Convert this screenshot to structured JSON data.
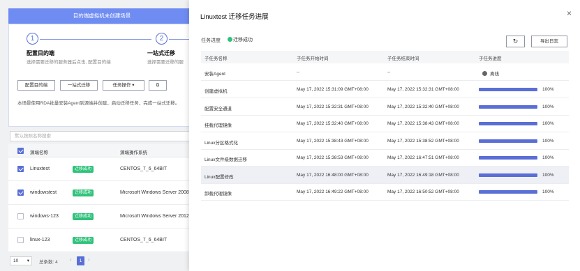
{
  "background": {
    "banner": "目的端虚拟机未创建场景",
    "steps": [
      {
        "number": "1",
        "title": "配置目的端",
        "desc": "选择需要迁移的服务器后点击, 配置目的端"
      },
      {
        "number": "2",
        "title": "一站式迁移",
        "desc": "选择需要迁移的服"
      }
    ],
    "buttons": {
      "configure": "配置目的端",
      "oneStop": "一站式迁移",
      "taskOps": "任务操作",
      "taskOpsCaret": "▾",
      "external": "⧉"
    },
    "intro": "本场景使用RDA批量安装Agent到源端并创建，启动迁移任务，完成一站式迁移。",
    "search_placeholder": "默认按照名称搜索",
    "table": {
      "headers": {
        "name": "源端名称",
        "os": "源端操作系统"
      },
      "rows": [
        {
          "name": "Linuxtest",
          "status": "迁移成功",
          "os": "CENTOS_7_6_64BIT",
          "checked": true
        },
        {
          "name": "windowstest",
          "status": "迁移成功",
          "os": "Microsoft Windows Server 2008",
          "checked": true
        },
        {
          "name": "windows-123",
          "status": "迁移成功",
          "os": "Microsoft Windows Server 2012",
          "checked": false
        },
        {
          "name": "linux-123",
          "status": "迁移成功",
          "os": "CENTOS_7_6_64BIT",
          "checked": false
        }
      ]
    },
    "pager": {
      "pageSize": "10",
      "total": "总条数: 4",
      "current": "1",
      "prev": "‹",
      "next": "›"
    }
  },
  "panel": {
    "title": "Linuxtest 迁移任务进展",
    "close": "×",
    "progressLabel": "任务进度",
    "progressStatus": "迁移成功",
    "refresh": "↻",
    "export": "导出日志",
    "headers": {
      "name": "子任务名称",
      "start": "子任务开始时间",
      "end": "子任务结束时间",
      "progress": "子任务进度"
    },
    "tasks": [
      {
        "name": "安装Agent",
        "start": "--",
        "end": "--",
        "state": "offline",
        "progress_text": "离线"
      },
      {
        "name": "创建虚拟机",
        "start": "May 17, 2022 15:31:09 GMT+08:00",
        "end": "May 17, 2022 15:32:31 GMT+08:00",
        "progress": 1.0,
        "progress_text": "100%"
      },
      {
        "name": "配置安全通道",
        "start": "May 17, 2022 15:32:31 GMT+08:00",
        "end": "May 17, 2022 15:32:40 GMT+08:00",
        "progress": 1.0,
        "progress_text": "100%"
      },
      {
        "name": "挂载代理镜像",
        "start": "May 17, 2022 15:32:40 GMT+08:00",
        "end": "May 17, 2022 15:38:43 GMT+08:00",
        "progress": 1.0,
        "progress_text": "100%"
      },
      {
        "name": "Linux分区格式化",
        "start": "May 17, 2022 15:38:43 GMT+08:00",
        "end": "May 17, 2022 15:38:52 GMT+08:00",
        "progress": 1.0,
        "progress_text": "100%"
      },
      {
        "name": "Linux文件级数据迁移",
        "start": "May 17, 2022 15:38:53 GMT+08:00",
        "end": "May 17, 2022 16:47:51 GMT+08:00",
        "progress": 1.0,
        "progress_text": "100%"
      },
      {
        "name": "Linux配置修改",
        "start": "May 17, 2022 16:48:00 GMT+08:00",
        "end": "May 17, 2022 16:49:18 GMT+08:00",
        "progress": 1.0,
        "progress_text": "100%",
        "highlight": true
      },
      {
        "name": "卸载代理镜像",
        "start": "May 17, 2022 16:49:22 GMT+08:00",
        "end": "May 17, 2022 16:50:52 GMT+08:00",
        "progress": 1.0,
        "progress_text": "100%"
      }
    ]
  },
  "colors": {
    "accent": "#5a6fd6",
    "success": "#2fc27a",
    "banner": "#6f8cf2"
  }
}
